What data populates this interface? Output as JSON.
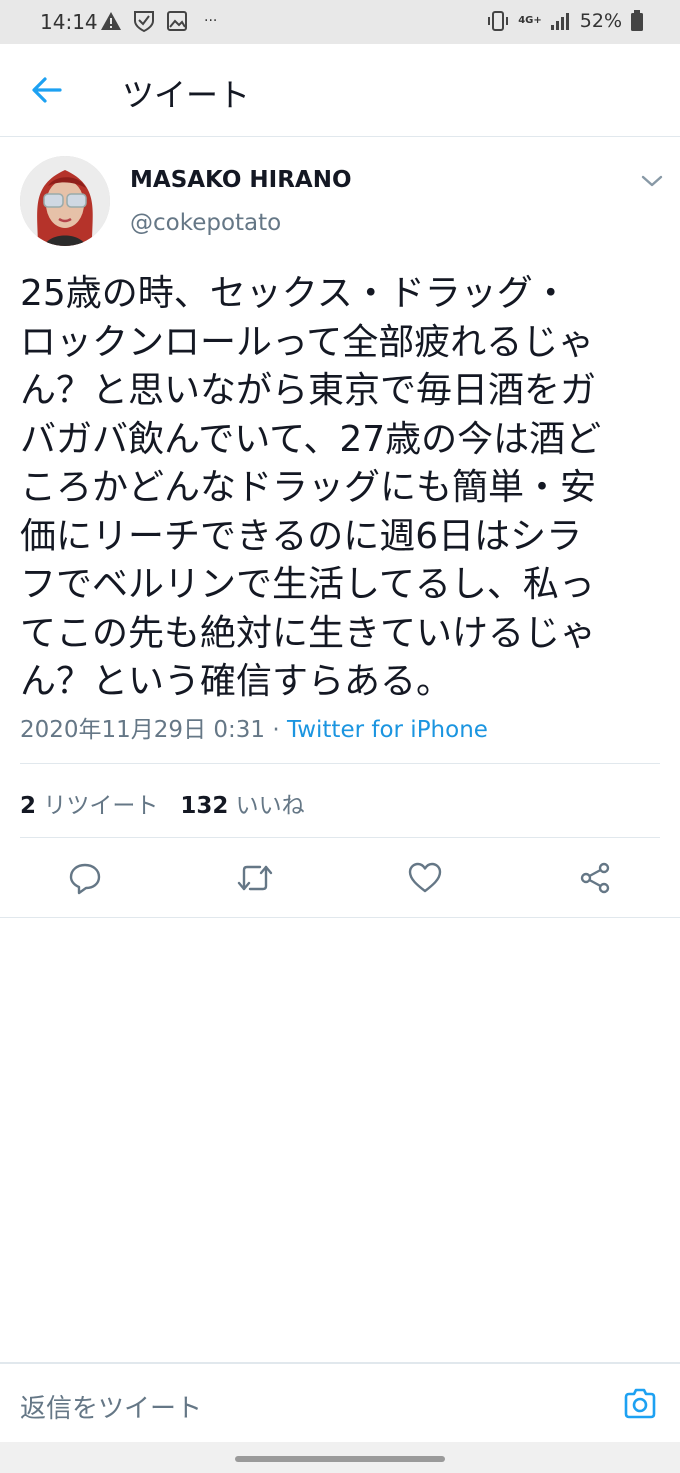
{
  "status_bar": {
    "time": "14:14",
    "network": "4G+",
    "battery": "52%",
    "overflow": "···"
  },
  "header": {
    "title": "ツイート",
    "back_icon": "arrow-left-icon"
  },
  "tweet": {
    "author_name": "MASAKO HIRANO",
    "author_handle": "@cokepotato",
    "text_lines": [
      "25歳の時、セックス・ドラッグ・",
      "ロックンロールって全部疲れるじゃ",
      "ん？と思いながら東京で毎日酒をガ",
      "バガバ飲んでいて、27歳の今は酒ど",
      "ころかどんなドラッグにも簡単・安",
      "価にリーチできるのに週6日はシラ",
      "フでベルリンで生活してるし、私っ",
      "てこの先も絶対に生きていけるじゃ",
      "ん？という確信すらある。"
    ],
    "timestamp": "2020年11月29日 0:31",
    "separator": " · ",
    "source": "Twitter for iPhone"
  },
  "stats": {
    "retweet_count": "2",
    "retweet_label": "リツイート",
    "like_count": "132",
    "like_label": "いいね"
  },
  "actions": [
    "reply-icon",
    "retweet-icon",
    "like-icon",
    "share-icon"
  ],
  "reply_bar": {
    "placeholder": "返信をツイート",
    "camera_icon": "camera-icon"
  },
  "colors": {
    "accent": "#1da1f2",
    "link": "#1b95e0",
    "secondary_text": "#657786",
    "primary_text": "#141823",
    "divider": "#e1e8ed"
  }
}
